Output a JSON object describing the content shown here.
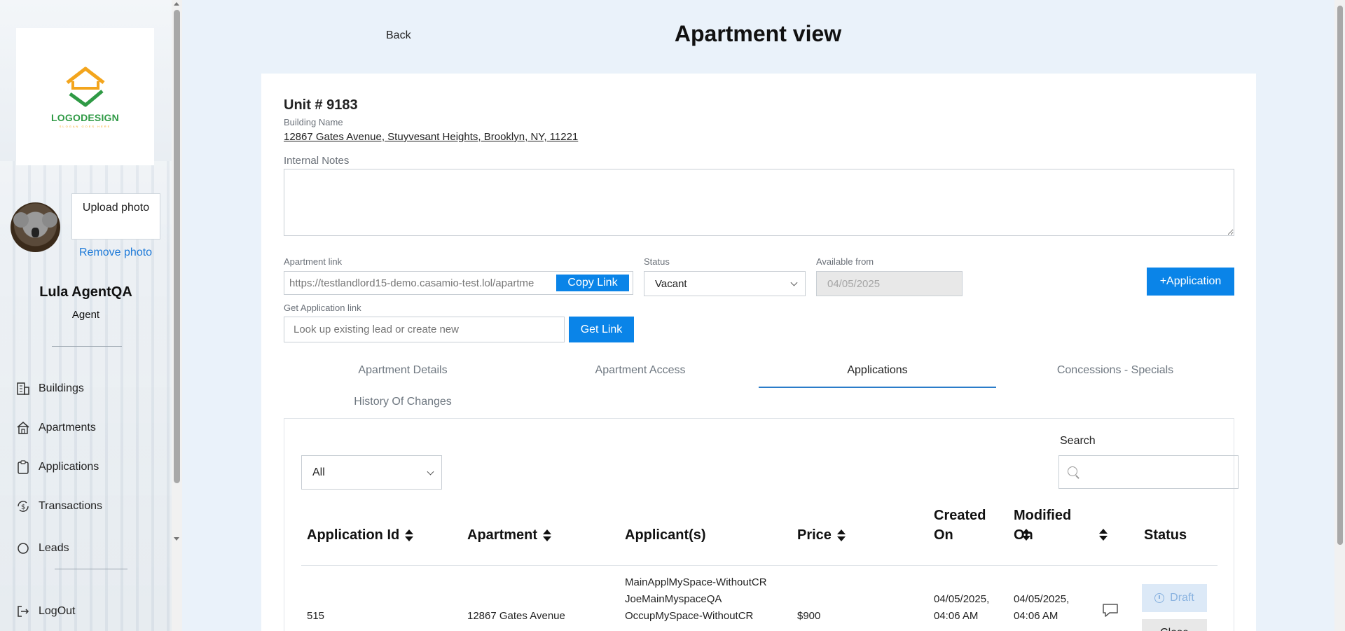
{
  "sidebar": {
    "logo": {
      "text": "LOGODESIGN",
      "subtext": "SLOGAN GOES HERE"
    },
    "upload_photo_label": "Upload photo",
    "remove_photo_label": "Remove photo",
    "user_name": "Lula AgentQA",
    "user_role": "Agent",
    "nav": [
      {
        "label": "Buildings",
        "icon": "building-icon"
      },
      {
        "label": "Apartments",
        "icon": "home-icon"
      },
      {
        "label": "Applications",
        "icon": "clipboard-icon"
      },
      {
        "label": "Transactions",
        "icon": "dollar-cycle-icon"
      },
      {
        "label": "Leads",
        "icon": "leads-icon"
      }
    ],
    "logout_label": "LogOut"
  },
  "header": {
    "back_label": "Back",
    "title": "Apartment view"
  },
  "unit": {
    "title": "Unit # 9183",
    "building_name_label": "Building Name",
    "address": "12867 Gates Avenue, Stuyvesant Heights, Brooklyn, NY, 11221",
    "internal_notes_label": "Internal Notes",
    "internal_notes_value": ""
  },
  "apartment_link": {
    "label": "Apartment link",
    "value": "https://testlandlord15-demo.casamio-test.lol/apartme",
    "copy_label": "Copy Link"
  },
  "status": {
    "label": "Status",
    "value": "Vacant"
  },
  "available_from": {
    "label": "Available from",
    "value": "04/05/2025"
  },
  "add_application_label": "+Application",
  "application_link": {
    "label": "Get Application link",
    "placeholder": "Look up existing lead or create new",
    "button_label": "Get Link"
  },
  "tabs": [
    {
      "label": "Apartment Details",
      "active": false
    },
    {
      "label": "Apartment Access",
      "active": false
    },
    {
      "label": "Applications",
      "active": true
    },
    {
      "label": "Concessions - Specials",
      "active": false
    },
    {
      "label": "History Of Changes",
      "active": false
    }
  ],
  "applications": {
    "filter_value": "All",
    "search_label": "Search",
    "search_value": "",
    "columns": [
      "Application Id",
      "Apartment",
      "Applicant(s)",
      "Price",
      "Created On",
      "Modified On",
      "Status"
    ],
    "rows": [
      {
        "id": "515",
        "apartment": "12867 Gates Avenue",
        "applicants": [
          "MainApplMySpace-WithoutCR",
          "JoeMainMyspaceQA",
          "OccupMySpace-WithoutCR"
        ],
        "price": "$900",
        "created_on": "04/05/2025, 04:06 AM",
        "modified_on": "04/05/2025, 04:06 AM",
        "status_label": "Draft",
        "close_label": "Close"
      }
    ]
  },
  "colors": {
    "primary": "#0a84e8",
    "tab_underline": "#2a7cc9",
    "link": "#1e7ad8",
    "background": "#eaf2fa"
  }
}
